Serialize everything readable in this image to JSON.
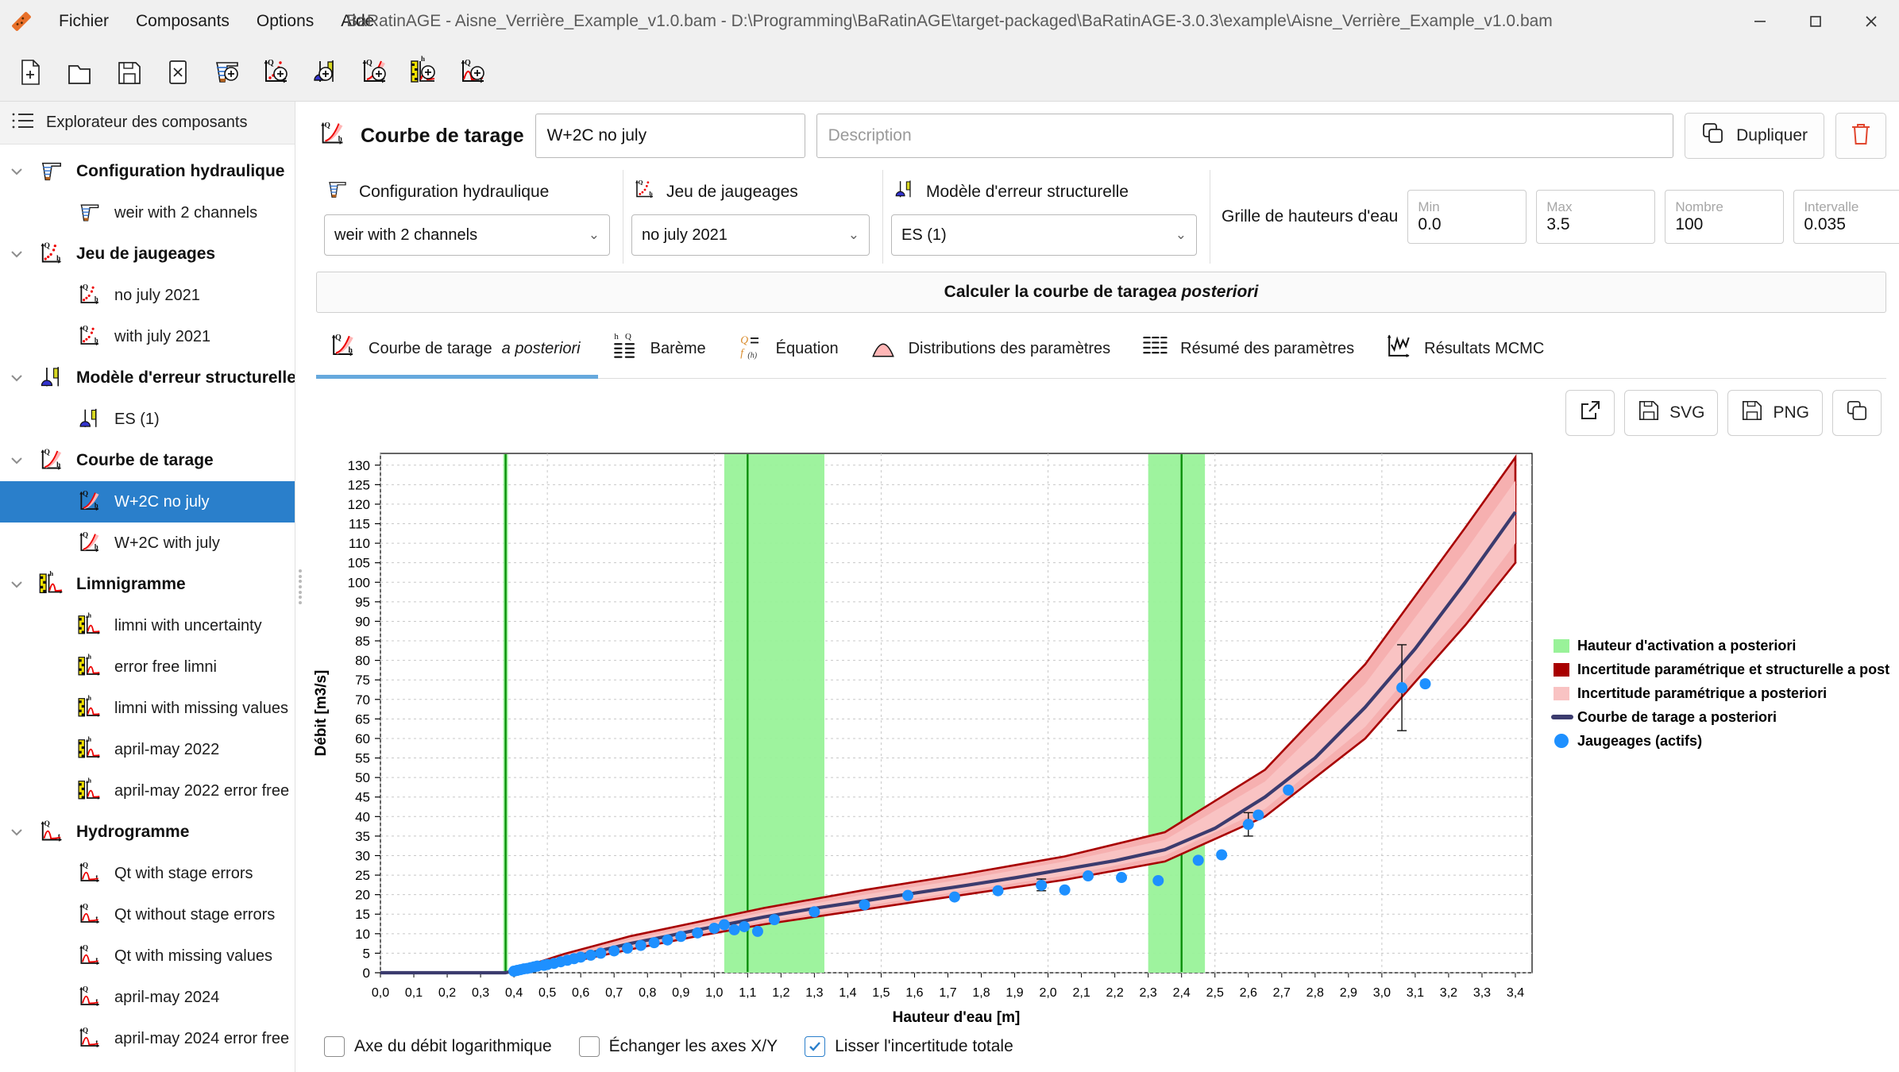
{
  "window": {
    "title": "BaRatinAGE - Aisne_Verrière_Example_v1.0.bam - D:\\Programming\\BaRatinAGE\\target-packaged\\BaRatinAGE-3.0.3\\example\\Aisne_Verrière_Example_v1.0.bam",
    "minimize": "—",
    "maximize": "▢",
    "close": "✕"
  },
  "menu": {
    "items": [
      {
        "label": "Fichier"
      },
      {
        "label": "Composants"
      },
      {
        "label": "Options"
      },
      {
        "label": "Aide"
      }
    ]
  },
  "toolbar": {
    "buttons": [
      {
        "name": "new-file-icon"
      },
      {
        "name": "open-folder-icon"
      },
      {
        "name": "save-icon"
      },
      {
        "name": "close-file-icon"
      },
      {
        "name": "add-hydraulic-config-icon"
      },
      {
        "name": "add-gauging-set-icon"
      },
      {
        "name": "add-structural-error-model-icon"
      },
      {
        "name": "add-rating-curve-icon"
      },
      {
        "name": "add-limnigraph-icon"
      },
      {
        "name": "add-hydrograph-icon"
      }
    ]
  },
  "sidebar": {
    "header": "Explorateur des composants",
    "tree": [
      {
        "label": "Configuration hydraulique",
        "type": "group",
        "icon": "hydraulic-config-icon"
      },
      {
        "label": "weir with 2 channels",
        "type": "leaf",
        "icon": "hydraulic-config-icon"
      },
      {
        "label": "Jeu de jaugeages",
        "type": "group",
        "icon": "gauging-set-icon"
      },
      {
        "label": "no july 2021",
        "type": "leaf",
        "icon": "gauging-set-icon"
      },
      {
        "label": "with july 2021",
        "type": "leaf",
        "icon": "gauging-set-icon"
      },
      {
        "label": "Modèle d'erreur structurelle",
        "type": "group",
        "icon": "structural-error-icon"
      },
      {
        "label": "ES (1)",
        "type": "leaf",
        "icon": "structural-error-icon"
      },
      {
        "label": "Courbe de tarage",
        "type": "group",
        "icon": "rating-curve-icon"
      },
      {
        "label": "W+2C no july",
        "type": "leaf",
        "icon": "rating-curve-icon",
        "selected": true
      },
      {
        "label": "W+2C with july",
        "type": "leaf",
        "icon": "rating-curve-icon"
      },
      {
        "label": "Limnigramme",
        "type": "group",
        "icon": "limnigraph-icon"
      },
      {
        "label": "limni with uncertainty",
        "type": "leaf",
        "icon": "limnigraph-icon"
      },
      {
        "label": "error free limni",
        "type": "leaf",
        "icon": "limnigraph-icon"
      },
      {
        "label": "limni with missing values",
        "type": "leaf",
        "icon": "limnigraph-icon"
      },
      {
        "label": "april-may 2022",
        "type": "leaf",
        "icon": "limnigraph-icon"
      },
      {
        "label": "april-may 2022 error free",
        "type": "leaf",
        "icon": "limnigraph-icon"
      },
      {
        "label": "Hydrogramme",
        "type": "group",
        "icon": "hydrograph-icon"
      },
      {
        "label": "Qt with stage errors",
        "type": "leaf",
        "icon": "hydrograph-icon"
      },
      {
        "label": "Qt without stage errors",
        "type": "leaf",
        "icon": "hydrograph-icon"
      },
      {
        "label": "Qt with missing values",
        "type": "leaf",
        "icon": "hydrograph-icon"
      },
      {
        "label": "april-may 2024",
        "type": "leaf",
        "icon": "hydrograph-icon"
      },
      {
        "label": "april-may 2024 error free",
        "type": "leaf",
        "icon": "hydrograph-icon"
      }
    ]
  },
  "component": {
    "type_label": "Courbe de tarage",
    "name_value": "W+2C no july",
    "description_placeholder": "Description",
    "duplicate_label": "Dupliquer",
    "delete_icon": "trash-icon"
  },
  "config": {
    "hydraulic": {
      "label": "Configuration hydraulique",
      "value": "weir with 2 channels"
    },
    "gaugings": {
      "label": "Jeu de jaugeages",
      "value": "no july 2021"
    },
    "error_model": {
      "label": "Modèle d'erreur structurelle",
      "value": "ES (1)"
    },
    "grid": {
      "label": "Grille de hauteurs d'eau",
      "fields": [
        {
          "placeholder": "Min",
          "value": "0.0"
        },
        {
          "placeholder": "Max",
          "value": "3.5"
        },
        {
          "placeholder": "Nombre",
          "value": "100"
        },
        {
          "placeholder": "Intervalle",
          "value": "0.035"
        }
      ]
    },
    "compute_button": {
      "prefix": "Calculer la courbe de tarage ",
      "italic": "a posteriori"
    }
  },
  "tabs": [
    {
      "label": "Courbe de tarage ",
      "italic": "a posteriori",
      "icon": "rating-curve-icon",
      "active": true
    },
    {
      "label": "Barème",
      "italic": "",
      "icon": "table-hq-icon",
      "active": false
    },
    {
      "label": "Équation",
      "italic": "",
      "icon": "equation-icon",
      "active": false
    },
    {
      "label": "Distributions des paramètres",
      "italic": "",
      "icon": "distribution-icon",
      "active": false
    },
    {
      "label": "Résumé des paramètres",
      "italic": "",
      "icon": "summary-table-icon",
      "active": false
    },
    {
      "label": "Résultats MCMC",
      "italic": "",
      "icon": "mcmc-icon",
      "active": false
    }
  ],
  "exports": [
    {
      "label": "",
      "icon": "open-external-icon"
    },
    {
      "label": "SVG",
      "icon": "save-icon"
    },
    {
      "label": "PNG",
      "icon": "save-icon"
    },
    {
      "label": "",
      "icon": "copy-icon"
    }
  ],
  "bottom_options": [
    {
      "label": "Axe du débit logarithmique",
      "checked": false
    },
    {
      "label": "Échanger les axes X/Y",
      "checked": false
    },
    {
      "label": "Lisser l'incertitude totale",
      "checked": true
    }
  ],
  "chart_data": {
    "type": "line",
    "title": "",
    "xlabel": "Hauteur d'eau [m]",
    "ylabel": "Débit [m3/s]",
    "xlim": [
      0.0,
      3.45
    ],
    "ylim": [
      0,
      133
    ],
    "grid": true,
    "legend_position": "right",
    "xticks": [
      "0,0",
      "0,1",
      "0,2",
      "0,3",
      "0,4",
      "0,5",
      "0,6",
      "0,7",
      "0,8",
      "0,9",
      "1,0",
      "1,1",
      "1,2",
      "1,3",
      "1,4",
      "1,5",
      "1,6",
      "1,7",
      "1,8",
      "1,9",
      "2,0",
      "2,1",
      "2,2",
      "2,3",
      "2,4",
      "2,5",
      "2,6",
      "2,7",
      "2,8",
      "2,9",
      "3,0",
      "3,1",
      "3,2",
      "3,3",
      "3,4"
    ],
    "yticks": [
      0,
      5,
      10,
      15,
      20,
      25,
      30,
      35,
      40,
      45,
      50,
      55,
      60,
      65,
      70,
      75,
      80,
      85,
      90,
      95,
      100,
      105,
      110,
      115,
      120,
      125,
      130
    ],
    "colors": {
      "activation": "#99f299",
      "total_uncertainty": "#a80000",
      "param_uncertainty": "#f9c3c3",
      "curve": "#3b3b6e",
      "gaugings": "#1e90ff"
    },
    "legend": [
      {
        "label": "Hauteur d'activation a posteriori",
        "marker": "square",
        "color": "#99f299"
      },
      {
        "label": "Incertitude paramétrique et structurelle a posteriori",
        "marker": "square",
        "color": "#a80000"
      },
      {
        "label": "Incertitude paramétrique a posteriori",
        "marker": "square",
        "color": "#f9c3c3"
      },
      {
        "label": "Courbe de tarage a posteriori",
        "marker": "line",
        "color": "#3b3b6e"
      },
      {
        "label": "Jaugeages (actifs)",
        "marker": "circle",
        "color": "#1e90ff"
      }
    ],
    "activation_bands": [
      {
        "center": 0.375,
        "from": 0.368,
        "to": 0.382
      },
      {
        "center": 1.1,
        "from": 1.03,
        "to": 1.33
      },
      {
        "center": 2.4,
        "from": 2.3,
        "to": 2.47
      }
    ],
    "rating_curve": {
      "x": [
        0.0,
        0.2,
        0.375,
        0.45,
        0.55,
        0.65,
        0.75,
        0.85,
        0.95,
        1.05,
        1.15,
        1.3,
        1.45,
        1.6,
        1.75,
        1.9,
        2.05,
        2.2,
        2.35,
        2.5,
        2.65,
        2.8,
        2.95,
        3.1,
        3.25,
        3.4
      ],
      "y": [
        0.0,
        0.0,
        0.0,
        1.5,
        3.5,
        5.5,
        7.5,
        9.2,
        11.0,
        12.6,
        14.3,
        16.5,
        18.4,
        20.4,
        22.3,
        24.3,
        26.5,
        28.7,
        31.5,
        37.0,
        45.0,
        55.0,
        68.0,
        83.0,
        100.0,
        118.0
      ]
    },
    "total_uncertainty_band": {
      "x": [
        0.375,
        0.55,
        0.75,
        0.95,
        1.15,
        1.45,
        1.75,
        2.05,
        2.35,
        2.65,
        2.95,
        3.25,
        3.4
      ],
      "lower": [
        0.0,
        2.4,
        6.0,
        9.4,
        12.4,
        16.2,
        20.0,
        23.8,
        28.5,
        40.0,
        60.0,
        89.0,
        105.0
      ],
      "upper": [
        0.0,
        4.8,
        9.4,
        13.0,
        16.6,
        21.2,
        25.3,
        29.8,
        36.0,
        52.0,
        79.0,
        114.0,
        132.0
      ]
    },
    "param_uncertainty_band": {
      "x": [
        0.375,
        0.55,
        0.75,
        0.95,
        1.15,
        1.45,
        1.75,
        2.05,
        2.35,
        2.65,
        2.95,
        3.25,
        3.4
      ],
      "lower": [
        0.0,
        3.1,
        6.8,
        10.2,
        13.2,
        17.1,
        21.0,
        24.9,
        30.0,
        42.0,
        63.0,
        93.0,
        110.0
      ],
      "upper": [
        0.0,
        4.0,
        8.5,
        12.0,
        15.5,
        20.0,
        24.0,
        28.5,
        34.0,
        49.0,
        74.0,
        108.0,
        126.0
      ]
    },
    "gaugings": [
      {
        "h": 0.4,
        "q": 0.4
      },
      {
        "h": 0.41,
        "q": 0.6
      },
      {
        "h": 0.42,
        "q": 0.8
      },
      {
        "h": 0.43,
        "q": 1.0
      },
      {
        "h": 0.44,
        "q": 1.1
      },
      {
        "h": 0.45,
        "q": 1.3
      },
      {
        "h": 0.46,
        "q": 1.5
      },
      {
        "h": 0.47,
        "q": 1.7
      },
      {
        "h": 0.49,
        "q": 1.9
      },
      {
        "h": 0.5,
        "q": 2.1
      },
      {
        "h": 0.52,
        "q": 2.4
      },
      {
        "h": 0.54,
        "q": 2.8
      },
      {
        "h": 0.56,
        "q": 3.2
      },
      {
        "h": 0.58,
        "q": 3.6
      },
      {
        "h": 0.6,
        "q": 4.0
      },
      {
        "h": 0.63,
        "q": 4.5
      },
      {
        "h": 0.66,
        "q": 5.0
      },
      {
        "h": 0.7,
        "q": 5.6
      },
      {
        "h": 0.74,
        "q": 6.3
      },
      {
        "h": 0.78,
        "q": 7.0
      },
      {
        "h": 0.82,
        "q": 7.7
      },
      {
        "h": 0.86,
        "q": 8.4
      },
      {
        "h": 0.9,
        "q": 9.3
      },
      {
        "h": 0.95,
        "q": 10.2
      },
      {
        "h": 1.0,
        "q": 11.4
      },
      {
        "h": 1.03,
        "q": 12.3
      },
      {
        "h": 1.06,
        "q": 11.0
      },
      {
        "h": 1.09,
        "q": 11.8
      },
      {
        "h": 1.13,
        "q": 10.6
      },
      {
        "h": 1.18,
        "q": 13.6
      },
      {
        "h": 1.3,
        "q": 15.6
      },
      {
        "h": 1.45,
        "q": 17.4
      },
      {
        "h": 1.58,
        "q": 19.8
      },
      {
        "h": 1.72,
        "q": 19.4
      },
      {
        "h": 1.85,
        "q": 21.0
      },
      {
        "h": 1.98,
        "q": 22.4
      },
      {
        "h": 2.05,
        "q": 21.2
      },
      {
        "h": 2.12,
        "q": 24.8
      },
      {
        "h": 2.22,
        "q": 24.4
      },
      {
        "h": 2.33,
        "q": 23.6
      },
      {
        "h": 2.45,
        "q": 28.8
      },
      {
        "h": 2.52,
        "q": 30.2
      },
      {
        "h": 2.6,
        "q": 38.0
      },
      {
        "h": 2.63,
        "q": 40.4
      },
      {
        "h": 2.72,
        "q": 46.8
      },
      {
        "h": 3.06,
        "q": 73.0
      },
      {
        "h": 3.13,
        "q": 74.0
      }
    ],
    "gauging_error_bars": [
      {
        "h": 3.06,
        "q": 73.0,
        "low": 62.0,
        "high": 84.0
      },
      {
        "h": 2.6,
        "q": 38.0,
        "low": 35.0,
        "high": 41.0
      },
      {
        "h": 1.98,
        "q": 22.4,
        "low": 21.0,
        "high": 24.0
      }
    ]
  }
}
